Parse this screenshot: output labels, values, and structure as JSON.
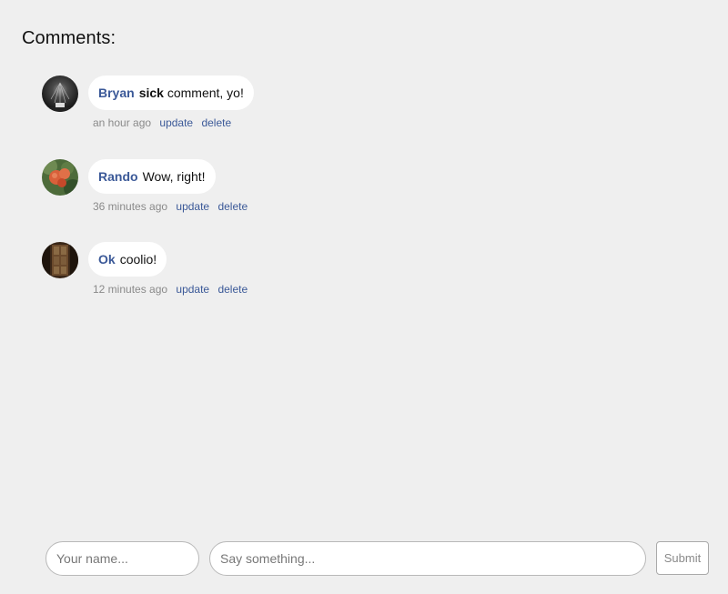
{
  "header": {
    "title": "Comments:"
  },
  "comments": [
    {
      "author": "Bryan",
      "text_bold": "sick",
      "text": "comment, yo!",
      "time": "an hour ago",
      "update_label": "update",
      "delete_label": "delete",
      "avatar_icon": "avatar-photo-dark-tunnel"
    },
    {
      "author": "Rando",
      "text_bold": "",
      "text": "Wow, right!",
      "time": "36 minutes ago",
      "update_label": "update",
      "delete_label": "delete",
      "avatar_icon": "avatar-photo-orange-fruit"
    },
    {
      "author": "Ok",
      "text_bold": "",
      "text": "coolio!",
      "time": "12 minutes ago",
      "update_label": "update",
      "delete_label": "delete",
      "avatar_icon": "avatar-photo-wooden-door"
    }
  ],
  "form": {
    "name_placeholder": "Your name...",
    "name_value": "",
    "message_placeholder": "Say something...",
    "message_value": "",
    "submit_label": "Submit"
  },
  "colors": {
    "background": "#efefef",
    "author_link": "#3b5998",
    "meta_text": "#8a8a8a",
    "bubble": "#ffffff"
  }
}
